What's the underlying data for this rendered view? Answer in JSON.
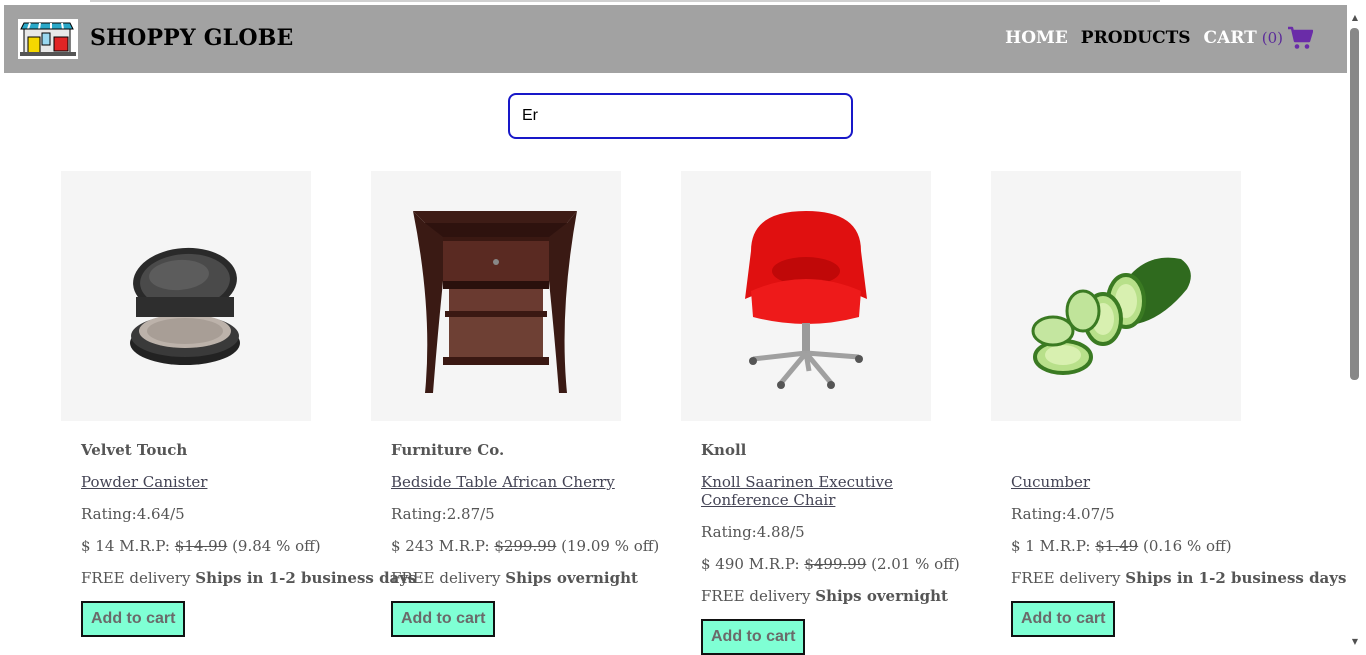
{
  "header": {
    "brand": "SHOPPY GLOBE",
    "nav": {
      "home": "HOME",
      "products": "PRODUCTS",
      "cart": "CART",
      "cart_count": "(0)"
    }
  },
  "search": {
    "value": "Er",
    "placeholder": ""
  },
  "colors": {
    "header_bg": "#a2a2a2",
    "button_bg": "#7fffd4",
    "search_border": "#1818c8",
    "cart_icon": "#6a2ca8"
  },
  "products": [
    {
      "brand": "Velvet Touch",
      "title": "Powder Canister",
      "rating_label": "Rating:",
      "rating": "4.64/5",
      "price": "$ 14",
      "mrp_label": "M.R.P:",
      "mrp": "$14.99",
      "discount": "(9.84 % off)",
      "delivery_label": "FREE delivery",
      "shipping": "Ships in 1-2 business days",
      "button": "Add to cart",
      "image_icon": "powder-compact"
    },
    {
      "brand": "Furniture Co.",
      "title": "Bedside Table African Cherry",
      "rating_label": "Rating:",
      "rating": "2.87/5",
      "price": "$ 243",
      "mrp_label": "M.R.P:",
      "mrp": "$299.99",
      "discount": "(19.09 % off)",
      "delivery_label": "FREE delivery",
      "shipping": "Ships overnight",
      "button": "Add to cart",
      "image_icon": "bedside-table"
    },
    {
      "brand": "Knoll",
      "title": "Knoll Saarinen Executive Conference Chair",
      "rating_label": "Rating:",
      "rating": "4.88/5",
      "price": "$ 490",
      "mrp_label": "M.R.P:",
      "mrp": "$499.99",
      "discount": "(2.01 % off)",
      "delivery_label": "FREE delivery",
      "shipping": "Ships overnight",
      "button": "Add to cart",
      "image_icon": "office-chair"
    },
    {
      "brand": "",
      "title": "Cucumber",
      "rating_label": "Rating:",
      "rating": "4.07/5",
      "price": "$ 1",
      "mrp_label": "M.R.P:",
      "mrp": "$1.49",
      "discount": "(0.16 % off)",
      "delivery_label": "FREE delivery",
      "shipping": "Ships in 1-2 business days",
      "button": "Add to cart",
      "image_icon": "cucumber"
    }
  ]
}
